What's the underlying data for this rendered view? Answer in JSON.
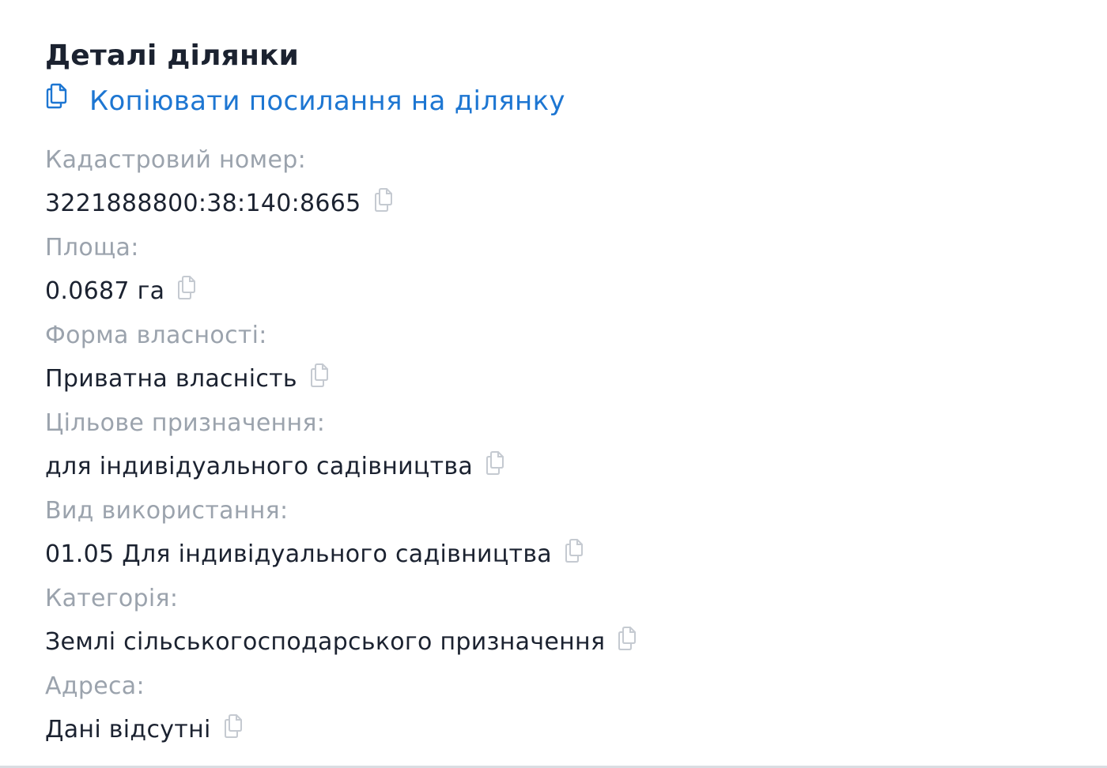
{
  "header": {
    "title": "Деталі ділянки",
    "copy_link_label": "Копіювати посилання на ділянку",
    "copy_link_icon": "copy-icon"
  },
  "fields": [
    {
      "label": "Кадастровий номер:",
      "value": "3221888800:38:140:8665"
    },
    {
      "label": "Площа:",
      "value": "0.0687 га"
    },
    {
      "label": "Форма власності:",
      "value": "Приватна власність"
    },
    {
      "label": "Цільове призначення:",
      "value": "для індивідуального садівництва"
    },
    {
      "label": "Вид використання:",
      "value": "01.05 Для індивідуального садівництва"
    },
    {
      "label": "Категорія:",
      "value": "Землі сільськогосподарського призначення"
    },
    {
      "label": "Адреса:",
      "value": "Дані відсутні"
    }
  ],
  "colors": {
    "link": "#1d76d2",
    "label": "#9ba3ad",
    "value": "#1b2230",
    "icon_muted": "#c5cad1"
  }
}
